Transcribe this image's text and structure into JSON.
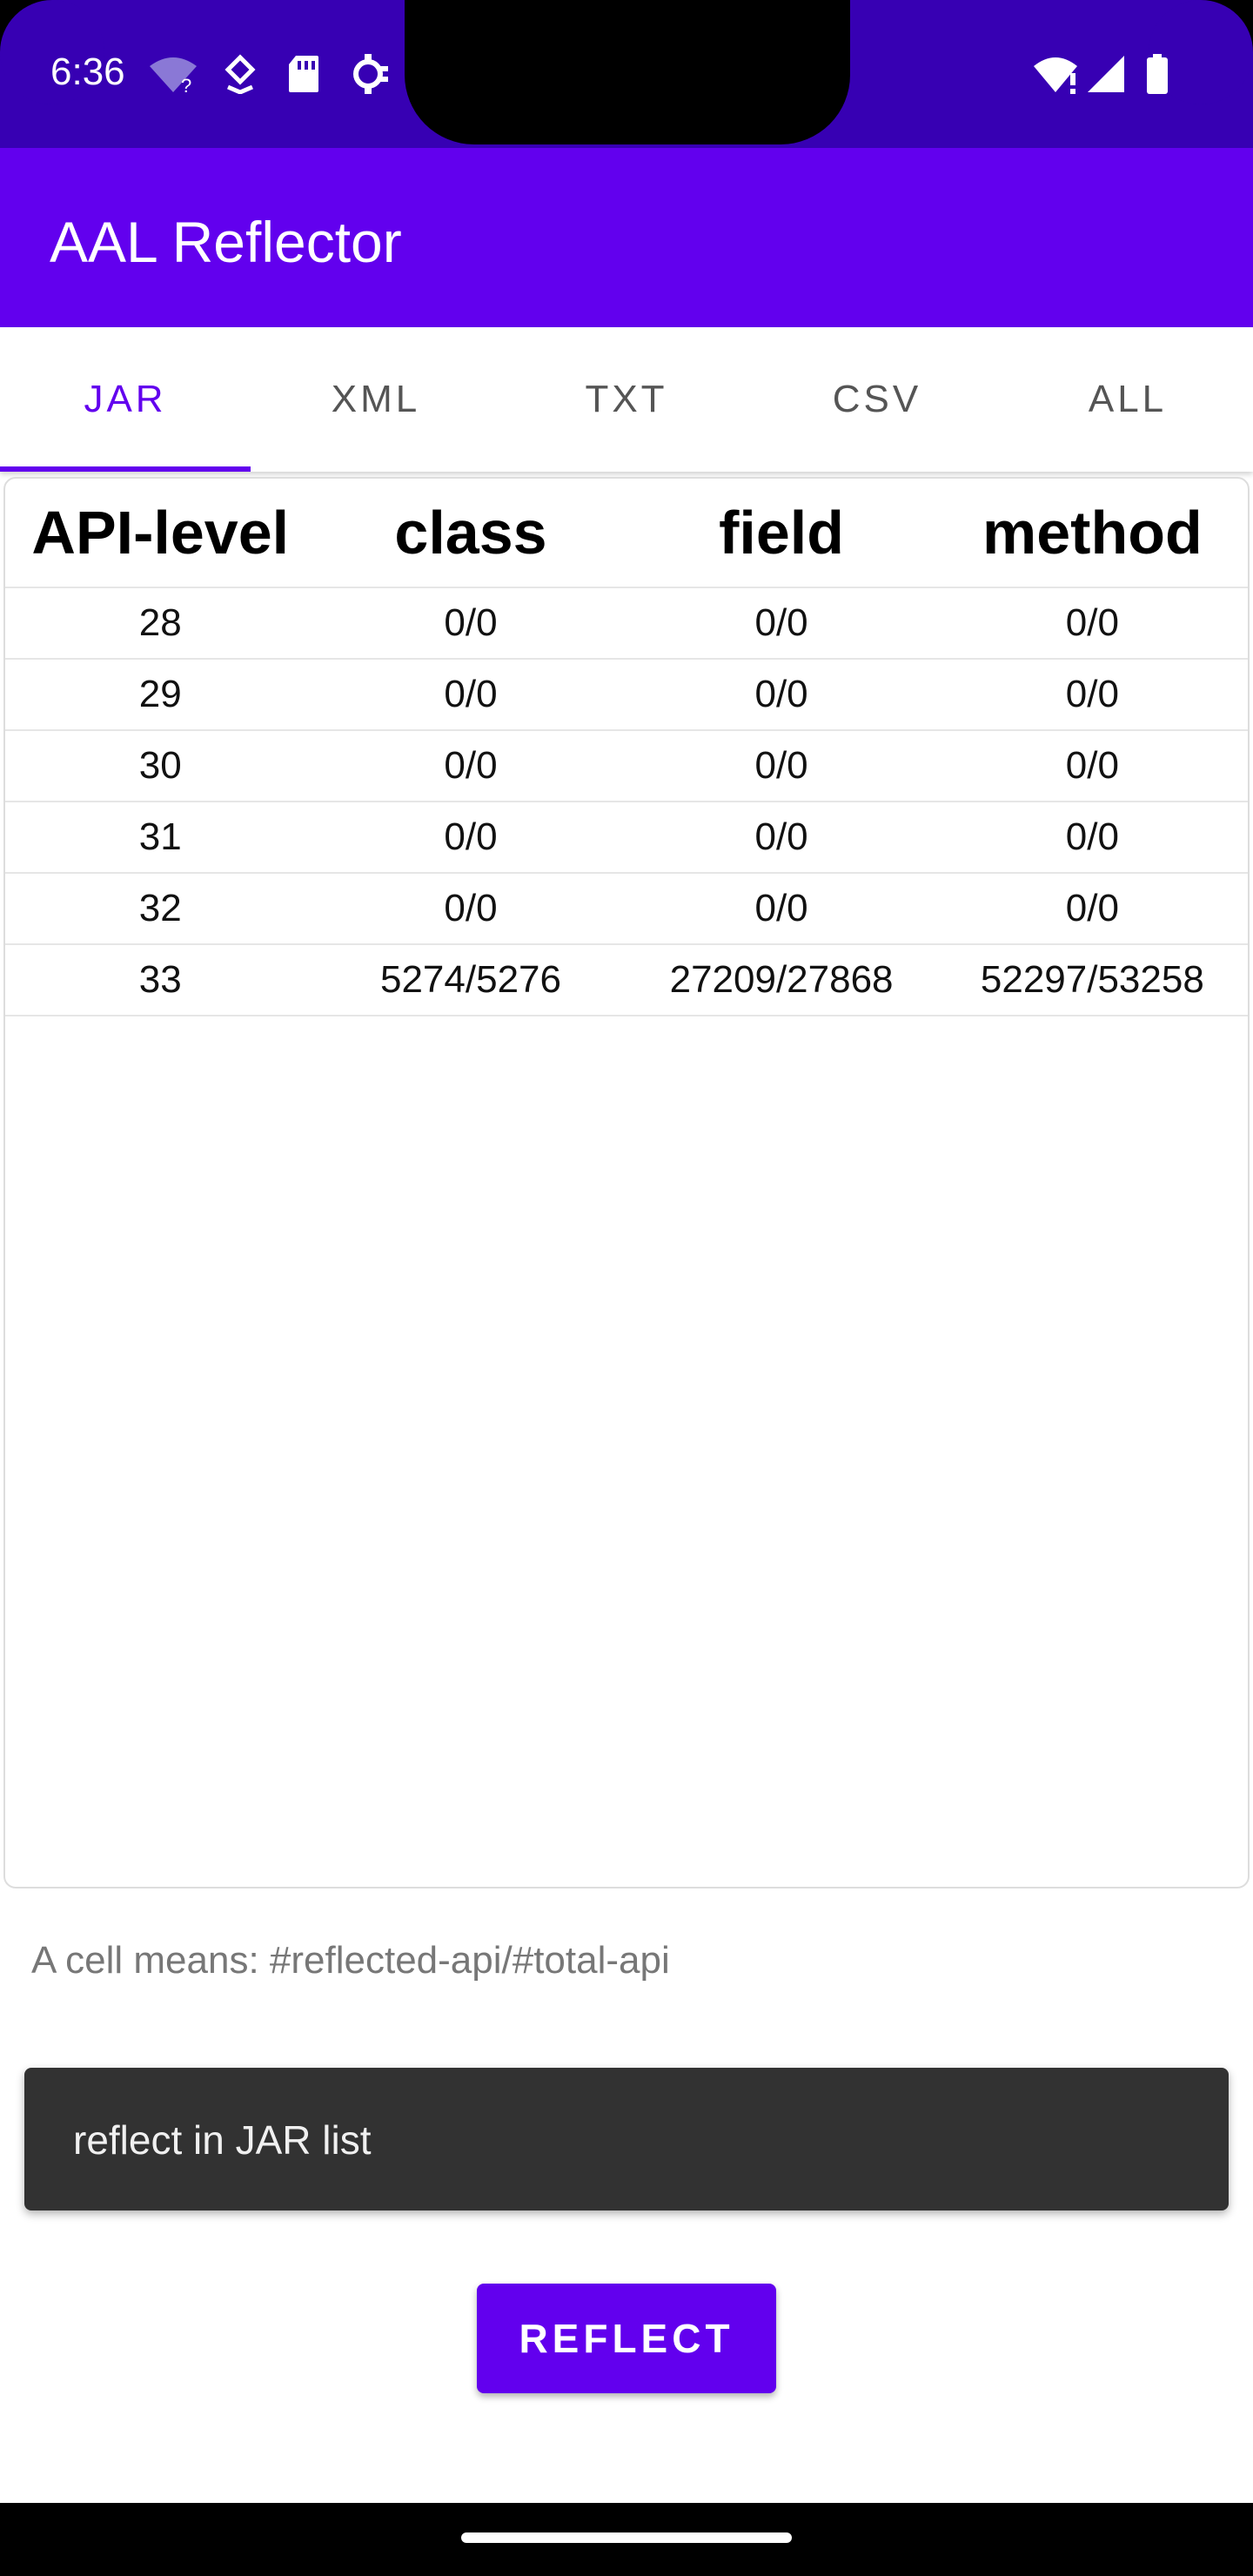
{
  "status_bar": {
    "time": "6:36",
    "left_icons": [
      "wifi-question-icon",
      "data-saver-icon",
      "sd-card-icon",
      "vpn-key-icon"
    ],
    "right_icons": [
      "wifi-alert-icon",
      "signal-icon",
      "battery-icon"
    ]
  },
  "app_bar": {
    "title": "AAL Reflector",
    "color": "#6200ee",
    "status_color": "#3700b3"
  },
  "tabs": [
    {
      "label": "JAR",
      "active": true
    },
    {
      "label": "XML",
      "active": false
    },
    {
      "label": "TXT",
      "active": false
    },
    {
      "label": "CSV",
      "active": false
    },
    {
      "label": "ALL",
      "active": false
    }
  ],
  "table": {
    "headers": [
      "API-level",
      "class",
      "field",
      "method"
    ],
    "rows": [
      [
        "28",
        "0/0",
        "0/0",
        "0/0"
      ],
      [
        "29",
        "0/0",
        "0/0",
        "0/0"
      ],
      [
        "30",
        "0/0",
        "0/0",
        "0/0"
      ],
      [
        "31",
        "0/0",
        "0/0",
        "0/0"
      ],
      [
        "32",
        "0/0",
        "0/0",
        "0/0"
      ],
      [
        "33",
        "5274/5276",
        "27209/27868",
        "52297/53258"
      ]
    ]
  },
  "note": "A cell means: #reflected-api/#total-api",
  "snackbar": {
    "message": "reflect in JAR list"
  },
  "action": {
    "reflect_label": "REFLECT"
  }
}
